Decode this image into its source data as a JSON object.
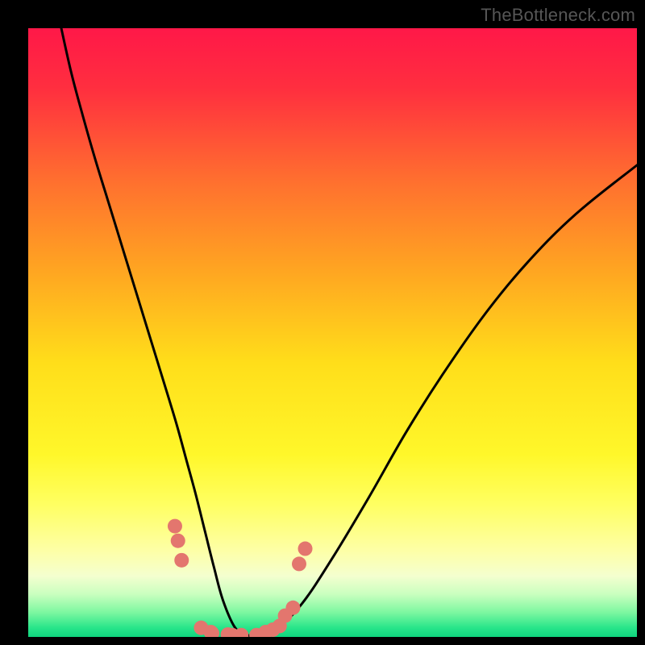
{
  "watermark": "TheBottleneck.com",
  "chart_data": {
    "type": "line",
    "title": "",
    "xlabel": "",
    "ylabel": "",
    "xlim": [
      0,
      100
    ],
    "ylim": [
      0,
      100
    ],
    "background_gradient": {
      "stops": [
        {
          "pos": 0.0,
          "color": "#ff1848"
        },
        {
          "pos": 0.1,
          "color": "#ff2f3f"
        },
        {
          "pos": 0.25,
          "color": "#ff6f2f"
        },
        {
          "pos": 0.4,
          "color": "#ffa621"
        },
        {
          "pos": 0.55,
          "color": "#ffde1a"
        },
        {
          "pos": 0.7,
          "color": "#fff72a"
        },
        {
          "pos": 0.78,
          "color": "#ffff60"
        },
        {
          "pos": 0.86,
          "color": "#fdffa8"
        },
        {
          "pos": 0.9,
          "color": "#f4ffcf"
        },
        {
          "pos": 0.93,
          "color": "#c9ffbf"
        },
        {
          "pos": 0.96,
          "color": "#7cf7a0"
        },
        {
          "pos": 0.985,
          "color": "#28e58a"
        },
        {
          "pos": 1.0,
          "color": "#0fd47d"
        }
      ]
    },
    "series": [
      {
        "name": "bottleneck-curve",
        "color": "#000000",
        "x": [
          5.0,
          7.0,
          9.0,
          11.0,
          13.0,
          15.0,
          17.0,
          19.0,
          21.0,
          23.0,
          24.5,
          26.0,
          27.5,
          29.0,
          30.5,
          32.0,
          34.0,
          36.0,
          38.0,
          41.0,
          45.0,
          50.0,
          56.0,
          62.0,
          68.0,
          75.0,
          82.0,
          90.0,
          100.0
        ],
        "values": [
          102.0,
          93.0,
          85.5,
          78.5,
          72.0,
          65.5,
          59.0,
          52.5,
          46.0,
          39.5,
          34.5,
          29.0,
          23.5,
          17.5,
          11.5,
          6.0,
          1.5,
          0.3,
          0.3,
          1.5,
          5.5,
          13.0,
          23.0,
          33.5,
          43.0,
          53.0,
          61.5,
          69.5,
          77.5
        ]
      }
    ],
    "markers": {
      "name": "highlight-dots",
      "color": "#e3766e",
      "radius_px": 9,
      "points": [
        {
          "x": 24.1,
          "y": 18.2
        },
        {
          "x": 24.6,
          "y": 15.8
        },
        {
          "x": 25.2,
          "y": 12.6
        },
        {
          "x": 28.4,
          "y": 1.5
        },
        {
          "x": 30.0,
          "y": 0.8
        },
        {
          "x": 30.2,
          "y": 0.6
        },
        {
          "x": 32.8,
          "y": 0.4
        },
        {
          "x": 33.5,
          "y": 0.3
        },
        {
          "x": 35.0,
          "y": 0.3
        },
        {
          "x": 37.5,
          "y": 0.3
        },
        {
          "x": 39.0,
          "y": 0.8
        },
        {
          "x": 40.2,
          "y": 1.2
        },
        {
          "x": 41.3,
          "y": 1.8
        },
        {
          "x": 42.2,
          "y": 3.5
        },
        {
          "x": 43.5,
          "y": 4.8
        },
        {
          "x": 44.5,
          "y": 12.0
        },
        {
          "x": 45.5,
          "y": 14.5
        }
      ]
    }
  }
}
